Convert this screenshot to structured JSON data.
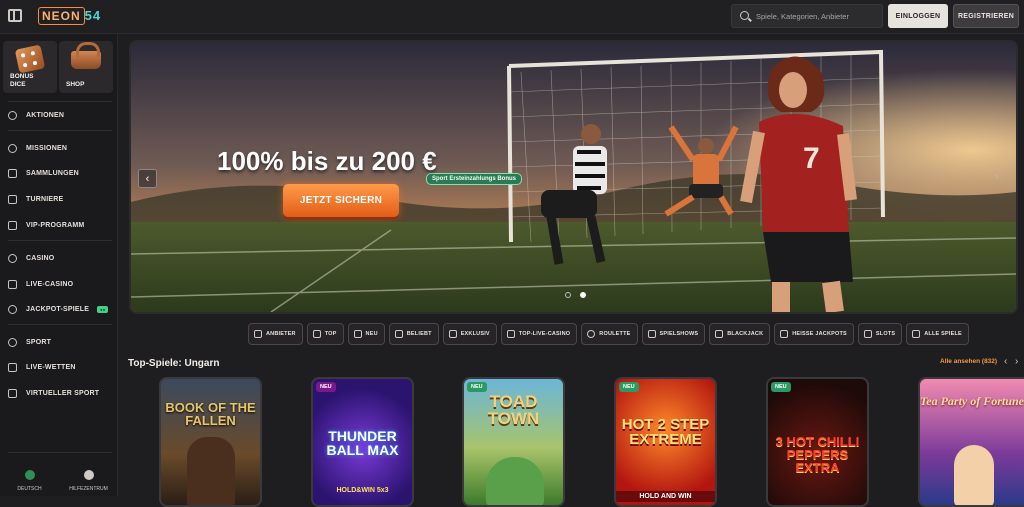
{
  "header": {
    "logo_text_a": "NEON",
    "logo_text_b": "54",
    "search_placeholder": "Spiele, Kategorien, Anbieter",
    "login_label": "EINLOGGEN",
    "register_label": "REGISTRIEREN"
  },
  "sidebar": {
    "tiles": [
      {
        "label_line1": "BONUS",
        "label_line2": "DICE"
      },
      {
        "label_line1": "SHOP",
        "label_line2": ""
      }
    ],
    "items": [
      {
        "label": "AKTIONEN",
        "icon": "gift-icon"
      },
      {
        "label": "MISSIONEN",
        "icon": "target-icon"
      },
      {
        "label": "SAMMLUNGEN",
        "icon": "collection-icon"
      },
      {
        "label": "TURNIERE",
        "icon": "trophy-icon"
      },
      {
        "label": "VIP-PROGRAMM",
        "icon": "crown-icon"
      },
      {
        "label": "CASINO",
        "icon": "chip-icon"
      },
      {
        "label": "LIVE-CASINO",
        "icon": "cards-icon"
      },
      {
        "label": "JACKPOT-SPIELE",
        "icon": "jackpot-icon"
      },
      {
        "label": "SPORT",
        "icon": "ball-icon"
      },
      {
        "label": "LIVE-WETTEN",
        "icon": "live-icon"
      },
      {
        "label": "VIRTUELLER SPORT",
        "icon": "virtual-sport-icon"
      }
    ],
    "footer": {
      "language": "DEUTSCH",
      "help": "HILFEZENTRUM"
    }
  },
  "hero": {
    "badge": "Sport Ersteinzahlungs Bonus",
    "title": "100% bis zu 200 €",
    "cta": "JETZT SICHERN",
    "active_slide": 2,
    "slides": 2,
    "jersey_number": "7"
  },
  "categories": [
    {
      "label": "ANBIETER",
      "icon": "provider-icon"
    },
    {
      "label": "TOP",
      "icon": "crown-icon"
    },
    {
      "label": "NEU",
      "icon": "bolt-icon"
    },
    {
      "label": "BELIEBT",
      "icon": "heart-icon"
    },
    {
      "label": "EXKLUSIV",
      "icon": "diamond-icon"
    },
    {
      "label": "TOP-LIVE-CASINO",
      "icon": "live-icon"
    },
    {
      "label": "ROULETTE",
      "icon": "roulette-icon"
    },
    {
      "label": "SPIELSHOWS",
      "icon": "mic-icon"
    },
    {
      "label": "BLACKJACK",
      "icon": "cards-icon"
    },
    {
      "label": "HEISSE JACKPOTS",
      "icon": "fire-icon"
    },
    {
      "label": "SLOTS",
      "icon": "slot-icon"
    },
    {
      "label": "ALLE SPIELE",
      "icon": "grid-icon"
    }
  ],
  "section": {
    "title": "Top-Spiele: Ungarn",
    "view_all": "Alle ansehen (832)"
  },
  "games": [
    {
      "title": "BOOK OF THE FALLEN",
      "new": false,
      "badge": ""
    },
    {
      "title": "THUNDER BALL MAX",
      "sub": "HOLD&WIN 5x3",
      "new": false,
      "badge": "NEU"
    },
    {
      "title": "TOAD TOWN",
      "new": true,
      "badge": "NEU"
    },
    {
      "title": "HOT 2 STEP EXTREME",
      "sub": "HOLD AND WIN",
      "new": true,
      "badge": "NEU"
    },
    {
      "title": "3 HOT CHILLI PEPPERS EXTRA",
      "new": true,
      "badge": "NEU"
    },
    {
      "title": "Tea Party of Fortune",
      "new": false,
      "badge": ""
    }
  ]
}
